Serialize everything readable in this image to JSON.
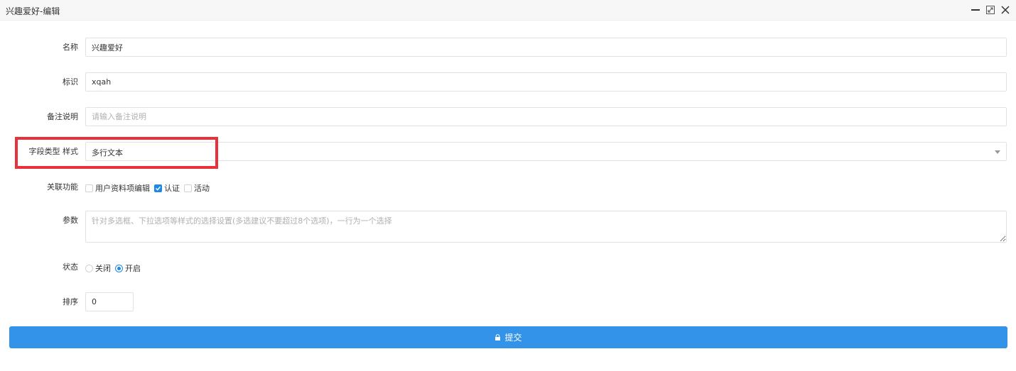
{
  "window": {
    "title": "兴趣爱好-编辑"
  },
  "form": {
    "name": {
      "label": "名称",
      "value": "兴趣爱好"
    },
    "identifier": {
      "label": "标识",
      "value": "xqah"
    },
    "remark": {
      "label": "备注说明",
      "value": "",
      "placeholder": "请输入备注说明"
    },
    "field_type": {
      "label": "字段类型 样式",
      "selected": "多行文本"
    },
    "related": {
      "label": "关联功能",
      "options": [
        {
          "label": "用户资料项编辑",
          "checked": false
        },
        {
          "label": "认证",
          "checked": true
        },
        {
          "label": "活动",
          "checked": false
        }
      ]
    },
    "params": {
      "label": "参数",
      "value": "",
      "placeholder": "针对多选框、下拉选项等样式的选择设置(多选建议不要超过8个选项)，一行为一个选择"
    },
    "status": {
      "label": "状态",
      "options": [
        {
          "label": "关闭",
          "checked": false
        },
        {
          "label": "开启",
          "checked": true
        }
      ]
    },
    "sort": {
      "label": "排序",
      "value": "0"
    },
    "submit_label": "提交"
  },
  "colors": {
    "accent": "#3393e8",
    "highlight": "#e8313a"
  }
}
